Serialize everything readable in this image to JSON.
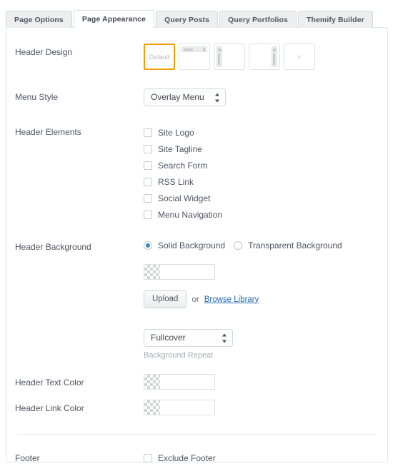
{
  "tabs": [
    {
      "label": "Page Options",
      "active": false
    },
    {
      "label": "Page Appearance",
      "active": true
    },
    {
      "label": "Query Posts",
      "active": false
    },
    {
      "label": "Query Portfolios",
      "active": false
    },
    {
      "label": "Themify Builder",
      "active": false
    }
  ],
  "header_design": {
    "label": "Header Design",
    "options": [
      {
        "name": "default",
        "text": "Default",
        "selected": true
      },
      {
        "name": "horizontal-bar",
        "text": "",
        "selected": false
      },
      {
        "name": "left-sidebar",
        "text": "",
        "selected": false
      },
      {
        "name": "right-sidebar",
        "text": "",
        "selected": false
      },
      {
        "name": "no-header",
        "text": "×",
        "selected": false
      }
    ],
    "selected_color": "#f0a007"
  },
  "menu_style": {
    "label": "Menu Style",
    "value": "Overlay Menu"
  },
  "header_elements": {
    "label": "Header Elements",
    "items": [
      {
        "label": "Site Logo",
        "checked": false
      },
      {
        "label": "Site Tagline",
        "checked": false
      },
      {
        "label": "Search Form",
        "checked": false
      },
      {
        "label": "RSS Link",
        "checked": false
      },
      {
        "label": "Social Widget",
        "checked": false
      },
      {
        "label": "Menu Navigation",
        "checked": false
      }
    ]
  },
  "header_background": {
    "label": "Header Background",
    "options": [
      {
        "label": "Solid Background",
        "selected": true
      },
      {
        "label": "Transparent Background",
        "selected": false
      }
    ],
    "accent_color": "#2b8ac6",
    "color_value": "",
    "color_placeholder": "",
    "upload_label": "Upload",
    "or_text": "or",
    "browse_label": "Browse Library",
    "repeat_value": "Fullcover",
    "repeat_caption": "Background Repeat"
  },
  "header_text_color": {
    "label": "Header Text Color",
    "value": ""
  },
  "header_link_color": {
    "label": "Header Link Color",
    "value": ""
  },
  "footer": {
    "label": "Footer",
    "exclude_label": "Exclude Footer",
    "exclude_checked": false
  }
}
